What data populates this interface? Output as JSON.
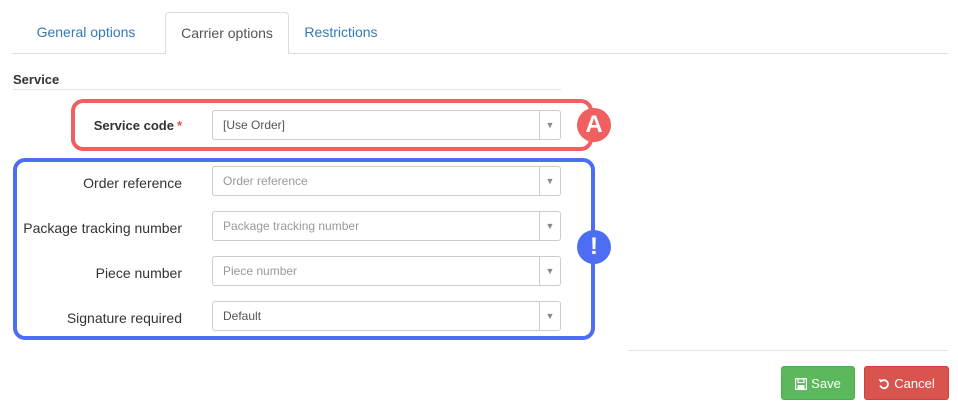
{
  "tabs": {
    "general": "General options",
    "carrier": "Carrier options",
    "restrictions": "Restrictions"
  },
  "section": {
    "title": "Service"
  },
  "fields": {
    "service_code": {
      "label": "Service code",
      "required_mark": "*",
      "value": "[Use Order]"
    },
    "order_reference": {
      "label": "Order reference",
      "placeholder": "Order reference"
    },
    "package_tracking": {
      "label": "Package tracking number",
      "placeholder": "Package tracking number"
    },
    "piece_number": {
      "label": "Piece number",
      "placeholder": "Piece number"
    },
    "signature_required": {
      "label": "Signature required",
      "value": "Default"
    }
  },
  "annotations": {
    "badge_a": "A",
    "badge_i": "!"
  },
  "buttons": {
    "save": "Save",
    "cancel": "Cancel"
  },
  "colors": {
    "link": "#337ab7",
    "save": "#5cb85c",
    "cancel": "#d9534f",
    "annotation_red": "#f06060",
    "annotation_blue": "#4d6ef2"
  }
}
